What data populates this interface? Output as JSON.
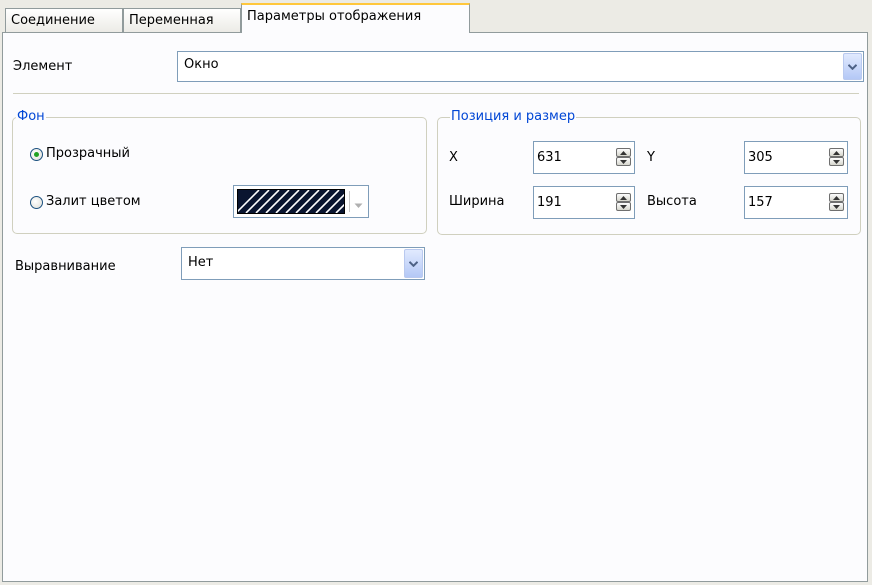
{
  "tabs": [
    {
      "label": "Соединение"
    },
    {
      "label": "Переменная"
    },
    {
      "label": "Параметры отображения"
    }
  ],
  "element": {
    "label": "Элемент",
    "value": "Окно"
  },
  "background": {
    "legend": "Фон",
    "transparent_label": "Прозрачный",
    "filled_label": "Залит цветом",
    "selected": "transparent"
  },
  "position": {
    "legend": "Позиция и размер",
    "x_label": "X",
    "x_value": "631",
    "y_label": "Y",
    "y_value": "305",
    "width_label": "Ширина",
    "width_value": "191",
    "height_label": "Высота",
    "height_value": "157"
  },
  "alignment": {
    "label": "Выравнивание",
    "value": "Нет"
  },
  "icons": {
    "combo_arrow": "chevron-down-icon",
    "spin_up": "arrow-up-icon",
    "spin_down": "arrow-down-icon",
    "color_swatch": "hatched-swatch-icon"
  },
  "colors": {
    "accent_tab": "#ffc73c",
    "legend_text": "#0046d5",
    "radio_dot": "#21a121"
  }
}
